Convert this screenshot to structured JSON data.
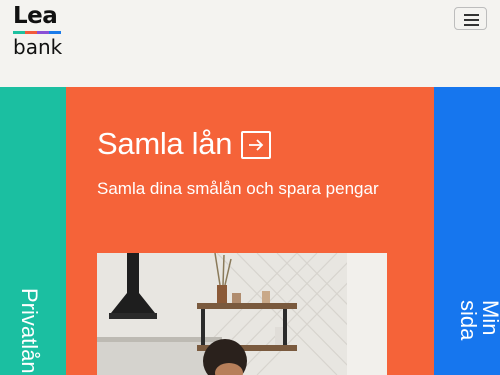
{
  "header": {
    "logo_top": "Lea",
    "logo_bottom": "bank",
    "menu_icon": "hamburger-icon"
  },
  "colors": {
    "left_panel": "#1bbfa1",
    "main_panel": "#f56339",
    "right_panel": "#1676ee",
    "header_bg": "#f4f3f0"
  },
  "panels": {
    "left_label": "Privatlån",
    "right_label": "Min sida"
  },
  "hero": {
    "title": "Samla lån",
    "arrow_icon": "arrow-right-icon",
    "subtitle": "Samla dina smålån och spara pengar",
    "image_subject": "woman in kitchen"
  }
}
